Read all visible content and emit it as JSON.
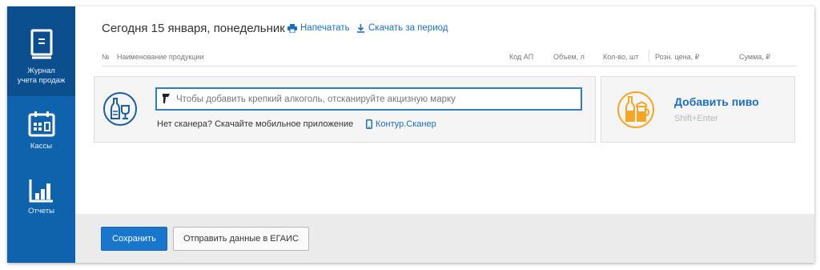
{
  "sidebar": {
    "items": [
      {
        "label_line1": "Журнал",
        "label_line2": "учета продаж",
        "icon": "journal-icon",
        "active": true
      },
      {
        "label": "Кассы",
        "icon": "cash-register-icon"
      },
      {
        "label": "Отчеты",
        "icon": "reports-chart-icon"
      }
    ]
  },
  "header": {
    "title": "Сегодня 15 января, понедельник",
    "print_label": "Напечатать",
    "download_label": "Скачать за период"
  },
  "table": {
    "columns": {
      "num": "№",
      "name": "Наименование продукции",
      "code": "Код АП",
      "volume": "Объем, л",
      "qty": "Кол-во, шт",
      "price": "Розн. цена, ₽",
      "sum": "Сумма, ₽"
    }
  },
  "scan": {
    "placeholder": "Чтобы добавить крепкий алкоголь, отсканируйте акцизную марку",
    "hint": "Нет сканера? Скачайте мобильное приложение",
    "app_link": "Контур.Сканер"
  },
  "beer": {
    "title": "Добавить пиво",
    "shortcut": "Shift+Enter"
  },
  "footer": {
    "save_label": "Сохранить",
    "send_label": "Отправить данные в ЕГАИС"
  },
  "colors": {
    "sidebar": "#0f62ac",
    "sidebar_active": "#0b4f8e",
    "link": "#1a6fc4",
    "beer_accent": "#f5a623"
  }
}
